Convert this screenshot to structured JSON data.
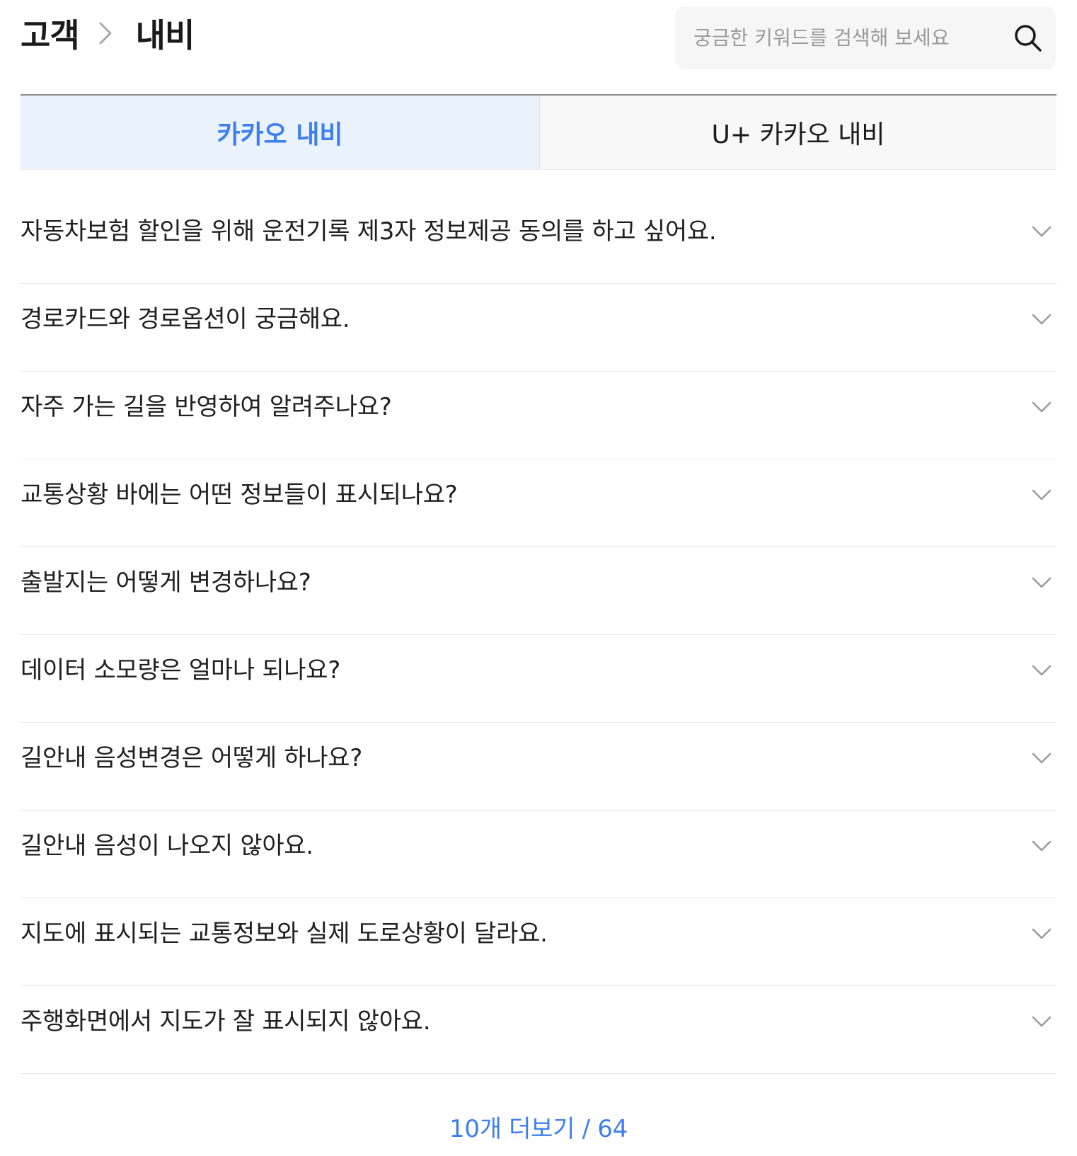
{
  "breadcrumb": {
    "parent": "고객",
    "current": "내비",
    "separator_icon": "chevron-right-icon"
  },
  "search": {
    "placeholder": "궁금한 키워드를 검색해 보세요",
    "value": "",
    "icon": "search-icon"
  },
  "tabs": [
    {
      "label": "카카오 내비",
      "active": true
    },
    {
      "label": "U+ 카카오 내비",
      "active": false
    }
  ],
  "faq": {
    "items": [
      {
        "question": "자동차보험 할인을 위해 운전기록 제3자 정보제공 동의를 하고 싶어요."
      },
      {
        "question": "경로카드와 경로옵션이 궁금해요."
      },
      {
        "question": "자주 가는 길을 반영하여 알려주나요?"
      },
      {
        "question": "교통상황 바에는 어떤 정보들이 표시되나요?"
      },
      {
        "question": "출발지는 어떻게 변경하나요?"
      },
      {
        "question": "데이터 소모량은 얼마나 되나요?"
      },
      {
        "question": "길안내 음성변경은 어떻게 하나요?"
      },
      {
        "question": "길안내 음성이 나오지 않아요."
      },
      {
        "question": "지도에 표시되는 교통정보와 실제 도로상황이 달라요."
      },
      {
        "question": "주행화면에서 지도가 잘 표시되지 않아요."
      }
    ],
    "expand_icon": "chevron-down-icon"
  },
  "more": {
    "label": "10개 더보기 / 64"
  },
  "colors": {
    "accent": "#3d7ef0",
    "active_tab_bg": "#eaf2fe",
    "inactive_tab_bg": "#f8f8f8",
    "search_bg": "#f6f6f6",
    "divider": "#e8e8e8",
    "chevron": "#9a9a9a"
  }
}
